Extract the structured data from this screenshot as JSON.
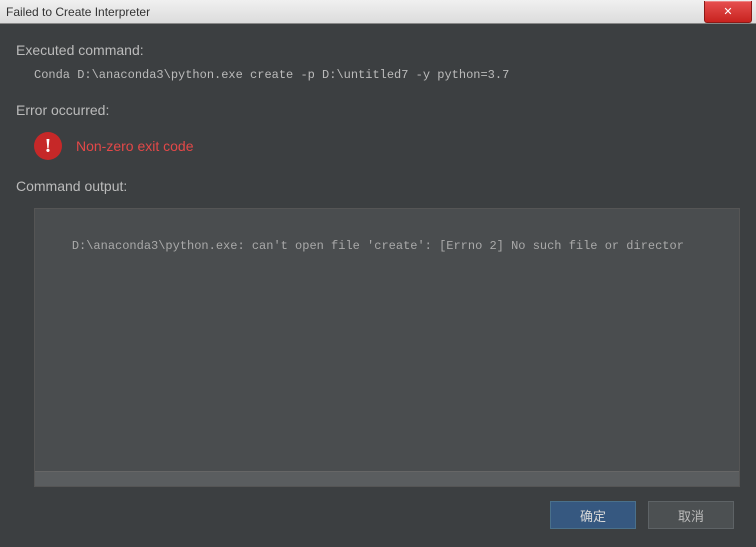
{
  "titlebar": {
    "title": "Failed to Create Interpreter",
    "close_symbol": "✕"
  },
  "sections": {
    "executed_heading": "Executed command:",
    "command": "Conda D:\\anaconda3\\python.exe create -p D:\\untitled7 -y python=3.7",
    "error_heading": "Error occurred:",
    "error_message": "Non-zero exit code",
    "error_icon_glyph": "!",
    "output_heading": "Command output:",
    "output_text": "D:\\anaconda3\\python.exe: can't open file 'create': [Errno 2] No such file or director"
  },
  "buttons": {
    "ok": "确定",
    "cancel": "取消"
  }
}
